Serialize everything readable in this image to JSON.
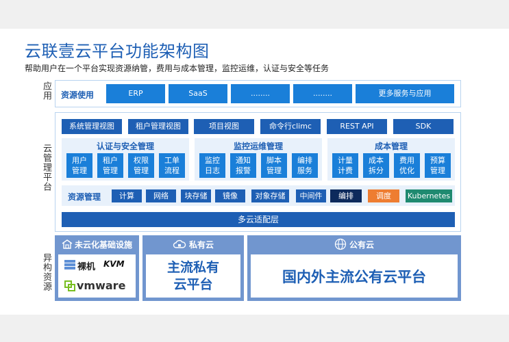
{
  "title": "云联壹云平台功能架构图",
  "subtitle": "帮助用户在一个平台实现资源纳管，费用与成本管理，监控运维，认证与安全等任务",
  "layers": {
    "app": "应用",
    "cloud_mgmt": "云管理平台",
    "hetero": "异构资源"
  },
  "app_row": {
    "label": "资源使用",
    "items": [
      "ERP",
      "SaaS",
      "........",
      "........",
      "更多服务与应用"
    ]
  },
  "views": [
    "系统管理视图",
    "租户管理视图",
    "项目视图",
    "命令行climc",
    "REST API",
    "SDK"
  ],
  "groups": [
    {
      "title": "认证与安全管理",
      "items": [
        "用户\n管理",
        "租户\n管理",
        "权限\n管理",
        "工单\n流程"
      ]
    },
    {
      "title": "监控运维管理",
      "items": [
        "监控\n日志",
        "通知\n报警",
        "脚本\n管理",
        "编排\n服务"
      ]
    },
    {
      "title": "成本管理",
      "items": [
        "计量\n计费",
        "成本\n拆分",
        "费用\n优化",
        "预算\n管理"
      ]
    }
  ],
  "resource_mgmt": {
    "label": "资源管理",
    "items": [
      {
        "label": "计算",
        "color": "#1e5fb4"
      },
      {
        "label": "网络",
        "color": "#1e5fb4"
      },
      {
        "label": "块存储",
        "color": "#1e5fb4"
      },
      {
        "label": "镜像",
        "color": "#1e5fb4"
      },
      {
        "label": "对象存储",
        "color": "#1e5fb4"
      },
      {
        "label": "中间件",
        "color": "#1e5fb4"
      },
      {
        "label": "编排",
        "color": "#0d2a5c"
      },
      {
        "label": "调度",
        "color": "#ee7d31"
      },
      {
        "label": "Kubernetes",
        "color": "#1f8a70"
      }
    ]
  },
  "adapter_layer": "多云适配层",
  "hetero_resources": {
    "on_prem": {
      "title": "未云化基础设施",
      "items": [
        "裸机",
        "KVM",
        "vmware"
      ]
    },
    "private": {
      "title": "私有云",
      "body": "主流私有云平台"
    },
    "public": {
      "title": "公有云",
      "body": "国内外主流公有云平台"
    }
  },
  "colors": {
    "brand": "#1e5fb4",
    "box_blue": "#1a7fd9",
    "hetero_bg": "#7196cf",
    "panel_border": "#b8d3ef"
  }
}
